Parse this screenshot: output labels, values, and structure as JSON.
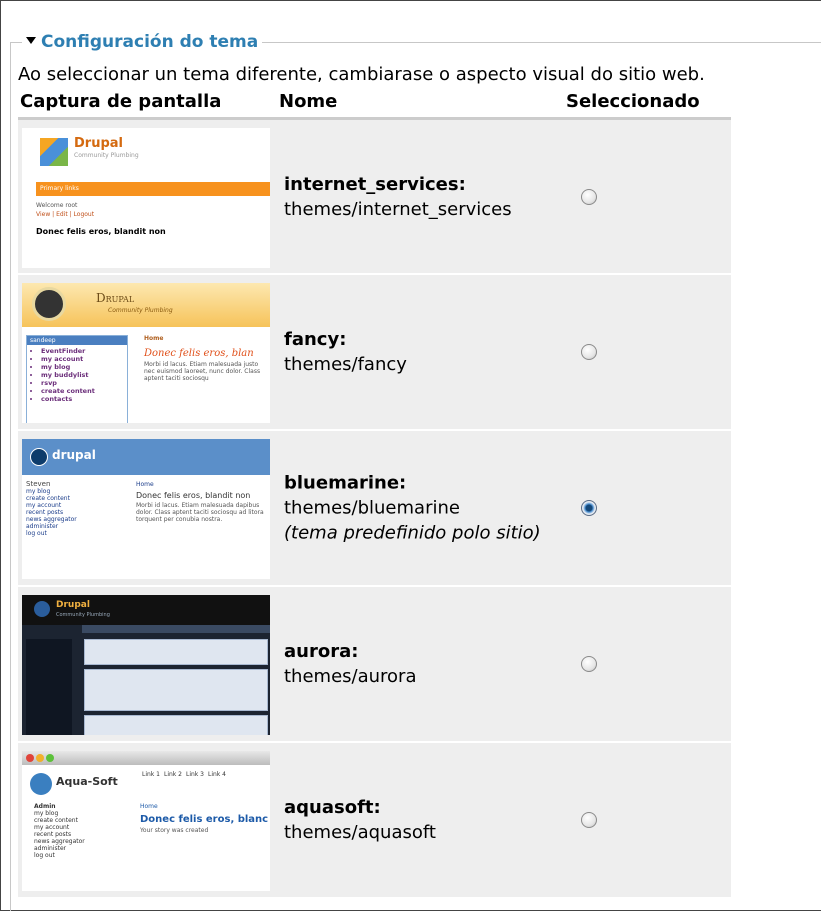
{
  "fieldset": {
    "legend": "Configuración do tema",
    "description": "Ao seleccionar un tema diferente, cambiarase o aspecto visual do sitio web."
  },
  "table": {
    "headers": [
      "Captura de pantalla",
      "Nome",
      "Seleccionado"
    ],
    "rows": [
      {
        "name": "internet_services:",
        "path": "themes/internet_services",
        "selected": false,
        "thumb": {
          "brand": "Drupal",
          "sub": "Community Plumbing",
          "bar": "Primary links",
          "welcome": "Welcome root",
          "links": "View | Edit | Logout",
          "title": "Donec felis eros, blandit non"
        }
      },
      {
        "name": "fancy:",
        "path": "themes/fancy",
        "selected": false,
        "thumb": {
          "brand": "Drupal",
          "sub": "Community Plumbing",
          "user": "sandeep",
          "menu": [
            "EventFinder",
            "my account",
            "my blog",
            "my buddylist",
            "rsvp",
            "create content",
            "contacts"
          ],
          "crumb": "Home",
          "title": "Donec felis eros, blan",
          "body": "Morbi id lacus. Etiam malesuada justo nec euismod laoreet, nunc dolor. Class aptent taciti sociosqu"
        }
      },
      {
        "name": "bluemarine:",
        "path": "themes/bluemarine",
        "default_note": "(tema predefinido polo sitio)",
        "selected": true,
        "thumb": {
          "brand": "drupal",
          "user": "Steven",
          "menu": [
            "my blog",
            "create content",
            "my account",
            "recent posts",
            "news aggregator",
            "administer",
            "log out"
          ],
          "crumb": "Home",
          "title": "Donec felis eros, blandit non",
          "body": "Morbi id lacus. Etiam malesuada dapibus dolor. Class aptent taciti sociosqu ad litora torquent per conubia nostra."
        }
      },
      {
        "name": "aurora:",
        "path": "themes/aurora",
        "selected": false,
        "thumb": {
          "brand": "Drupal",
          "sub": "Community Plumbing"
        }
      },
      {
        "name": "aquasoft:",
        "path": "themes/aquasoft",
        "selected": false,
        "thumb": {
          "brand": "Aqua-Soft",
          "links": [
            "Link 1",
            "Link 2",
            "Link 3",
            "Link 4"
          ],
          "user": "Admin",
          "menu": [
            "my blog",
            "create content",
            "my account",
            "recent posts",
            "news aggregator",
            "administer",
            "log out"
          ],
          "crumb": "Home",
          "title": "Donec felis eros, blanc",
          "body": "Your story was created"
        }
      }
    ]
  }
}
